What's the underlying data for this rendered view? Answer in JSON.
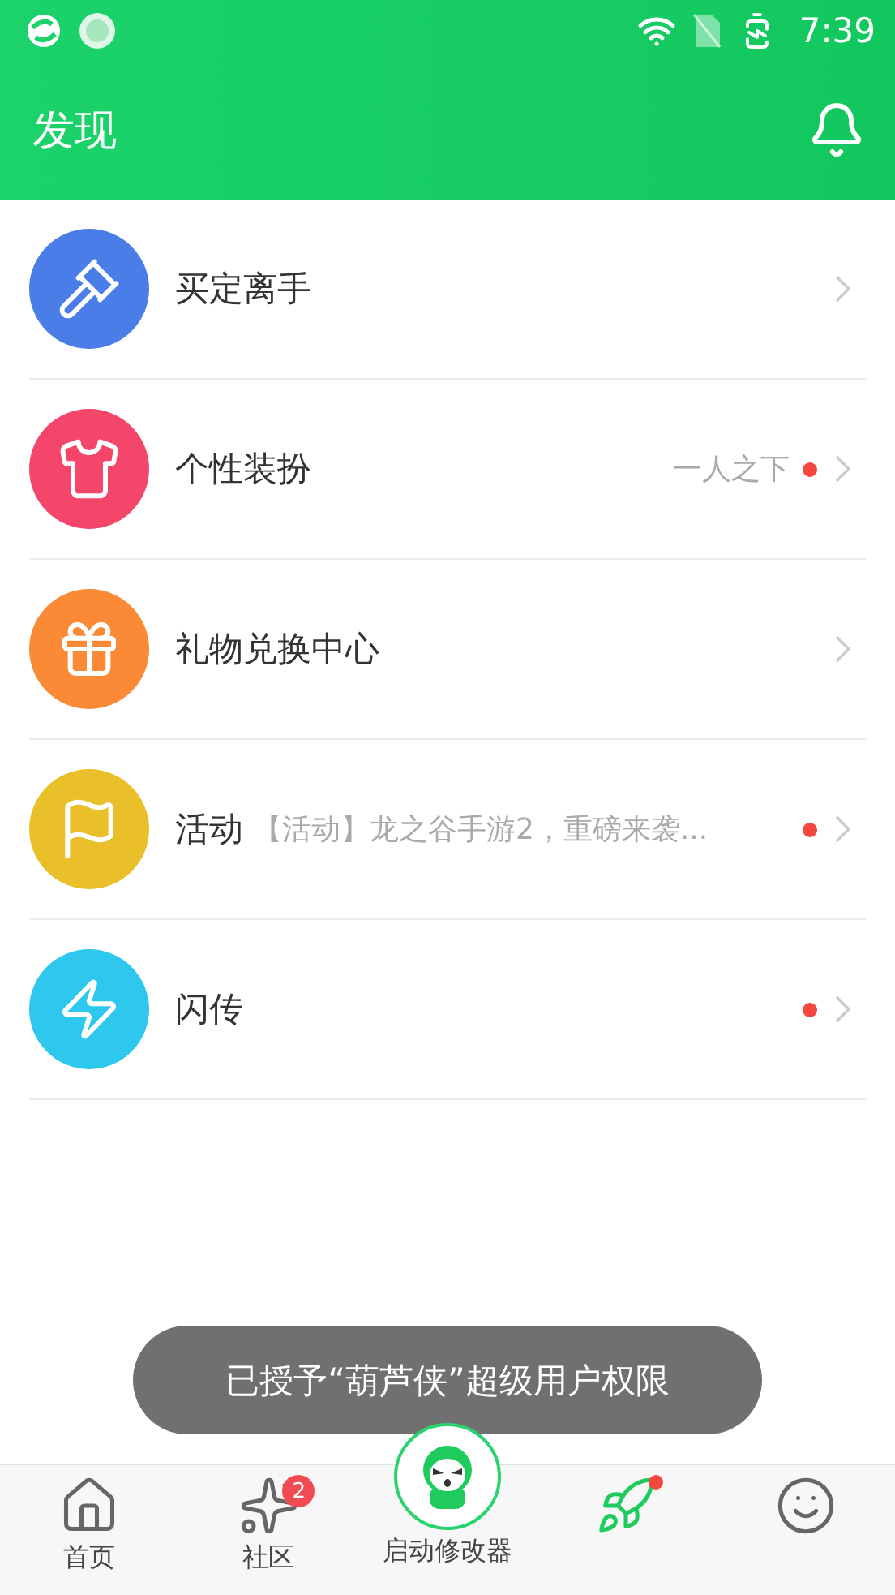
{
  "status_bar": {
    "time": "7:39"
  },
  "app_bar": {
    "title": "发现"
  },
  "items": [
    {
      "kind": "gavel",
      "color": "#4a7de8",
      "title": "买定离手",
      "dot": false
    },
    {
      "kind": "shirt",
      "color": "#f4456a",
      "title": "个性装扮",
      "subtitle": "一人之下",
      "dot": true
    },
    {
      "kind": "gift",
      "color": "#fa8a35",
      "title": "礼物兑换中心",
      "dot": false
    },
    {
      "kind": "flag",
      "color": "#e9c02a",
      "title": "活动",
      "subtitle": "【活动】龙之谷手游2，重磅来袭...",
      "dot": true
    },
    {
      "kind": "bolt",
      "color": "#2ec7ee",
      "title": "闪传",
      "dot": true
    }
  ],
  "toast": "已授予“葫芦侠”超级用户权限",
  "tabs": [
    {
      "kind": "home",
      "label": "首页",
      "dot": false
    },
    {
      "kind": "community",
      "label": "社区",
      "badge": "2",
      "dot": false
    },
    {
      "kind": "launch",
      "label": "启动修改器",
      "dot": false
    },
    {
      "kind": "rocket",
      "dot": true
    },
    {
      "kind": "face",
      "dot": false
    }
  ]
}
